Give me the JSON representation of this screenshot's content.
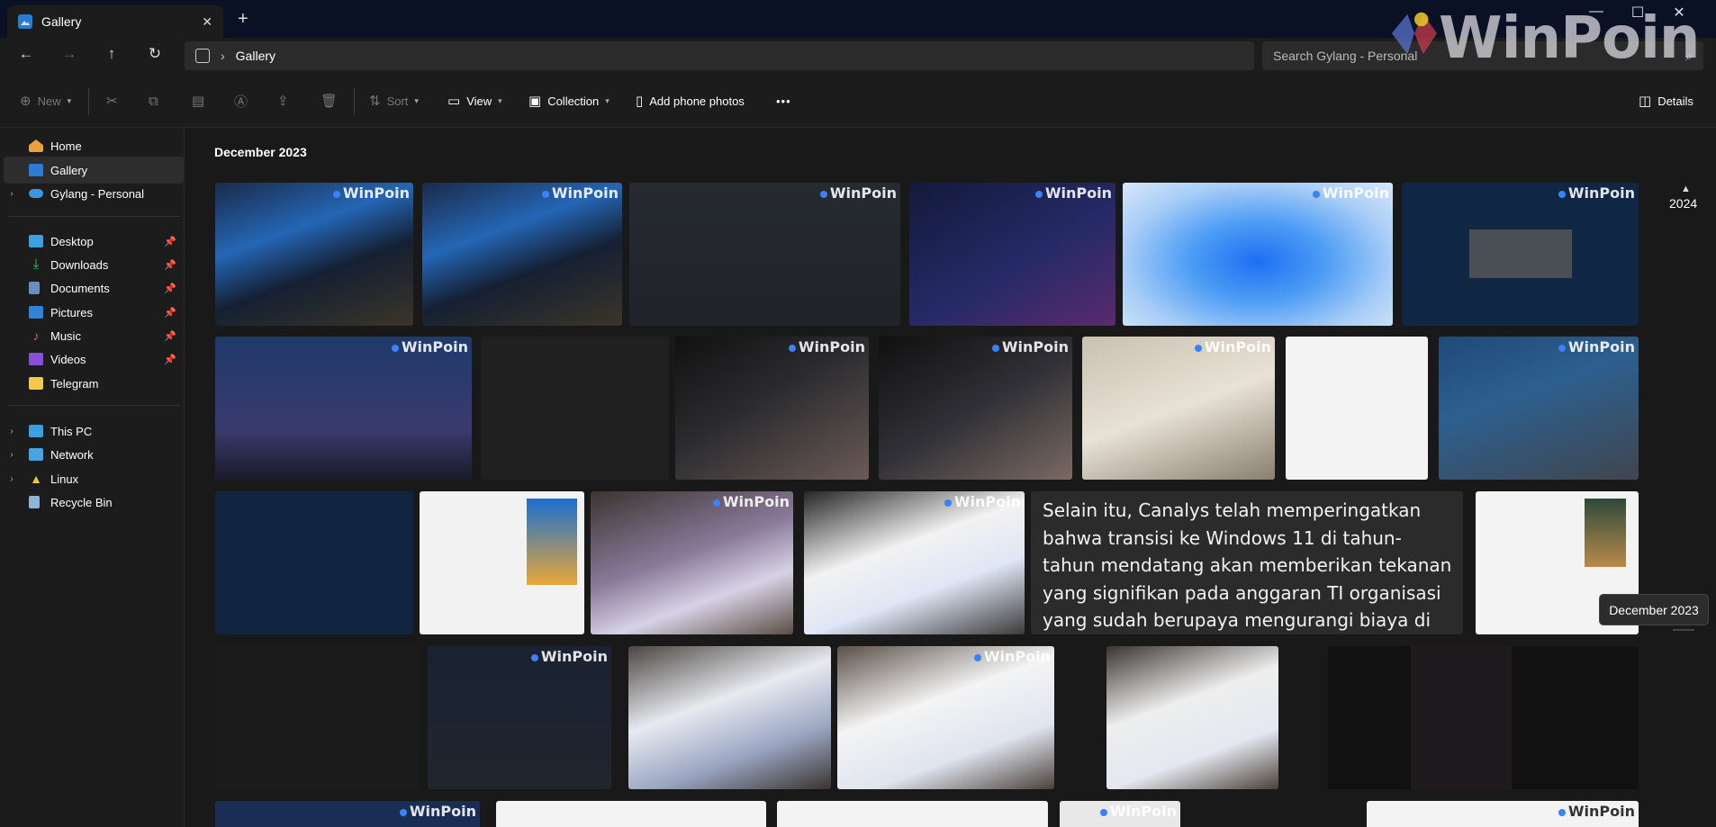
{
  "window": {
    "tab_title": "Gallery",
    "tab_close": "✕",
    "new_tab": "+",
    "minimize": "—",
    "maximize": "☐",
    "close": "✕"
  },
  "nav": {
    "back": "←",
    "forward": "→",
    "up": "↑",
    "refresh": "↻",
    "breadcrumb_sep": "›",
    "breadcrumb": "Gallery",
    "search_placeholder": "Search Gylang - Personal",
    "search_icon": "⌕"
  },
  "toolbar": {
    "new_label": "New",
    "sort_label": "Sort",
    "view_label": "View",
    "collection_label": "Collection",
    "add_phone_label": "Add phone photos",
    "more_label": "•••",
    "details_label": "Details"
  },
  "sidebar": {
    "items": [
      {
        "label": "Home",
        "icon": "home-icon"
      },
      {
        "label": "Gallery",
        "icon": "gallery-icon"
      },
      {
        "label": "Gylang - Personal",
        "icon": "onedrive-icon"
      },
      {
        "label": "Desktop",
        "icon": "desktop-icon"
      },
      {
        "label": "Downloads",
        "icon": "downloads-icon"
      },
      {
        "label": "Documents",
        "icon": "documents-icon"
      },
      {
        "label": "Pictures",
        "icon": "pictures-icon"
      },
      {
        "label": "Music",
        "icon": "music-icon"
      },
      {
        "label": "Videos",
        "icon": "videos-icon"
      },
      {
        "label": "Telegram",
        "icon": "folder-icon"
      },
      {
        "label": "This PC",
        "icon": "pc-icon"
      },
      {
        "label": "Network",
        "icon": "network-icon"
      },
      {
        "label": "Linux",
        "icon": "linux-icon"
      },
      {
        "label": "Recycle Bin",
        "icon": "recycle-bin-icon"
      }
    ]
  },
  "gallery": {
    "month_heading": "December 2023",
    "watermark": "WinPoin",
    "text_tile": "Selain itu, Canalys telah memperingatkan bahwa transisi ke Windows 11 di tahun-tahun mendatang akan memberikan tekanan yang signifikan pada anggaran TI organisasi yang sudah berupaya mengurangi biaya di tengah krisis ekonomi.",
    "timeline_year": "2024",
    "timeline_month_tip": "December 2023"
  },
  "logo": {
    "text": "WinPoin"
  },
  "colors": {
    "accent": "#60a5fa",
    "title_bar": "#0b1124",
    "chrome": "#1c1c1c",
    "content_bg": "#191919"
  }
}
